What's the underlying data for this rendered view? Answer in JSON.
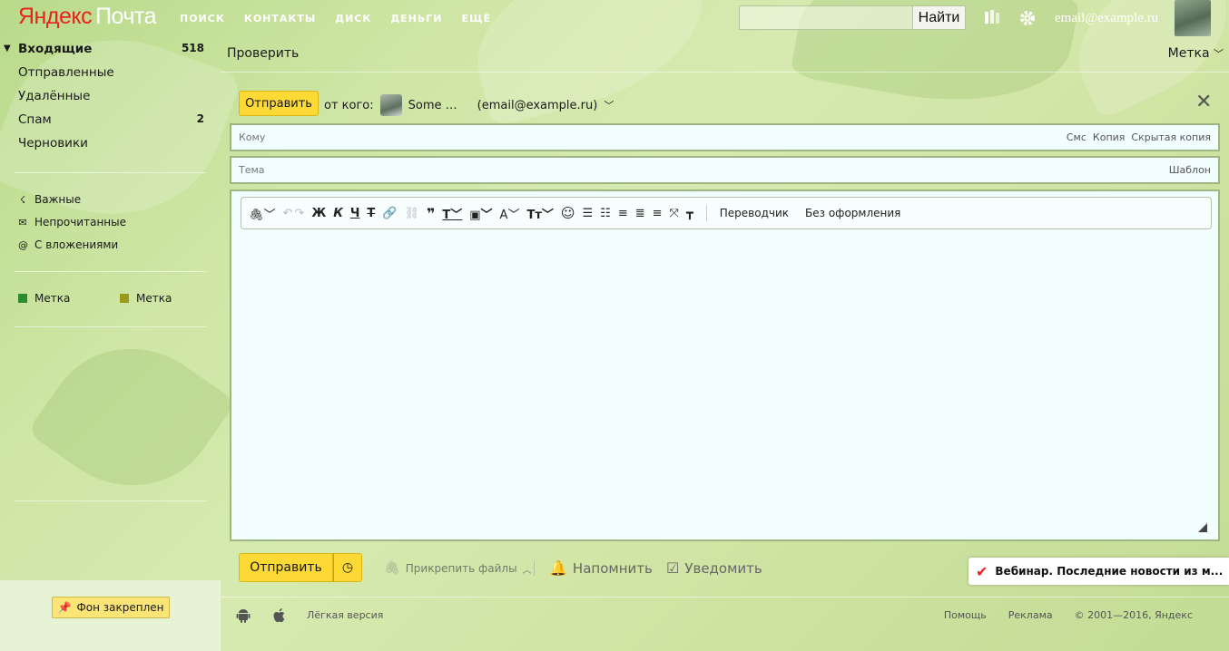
{
  "header": {
    "logo_brand": "Яндекс",
    "logo_product": "Почта",
    "nav": [
      "ПОИСК",
      "КОНТАКТЫ",
      "ДИСК",
      "ДЕНЬГИ",
      "ЕЩЁ"
    ],
    "search_button": "Найти",
    "search_placeholder": "",
    "user_email": "email@example.ru"
  },
  "sidebar": {
    "folders": [
      {
        "label": "Входящие",
        "count": "518",
        "active": true
      },
      {
        "label": "Отправленные",
        "count": ""
      },
      {
        "label": "Удалённые",
        "count": ""
      },
      {
        "label": "Спам",
        "count": "2"
      },
      {
        "label": "Черновики",
        "count": ""
      }
    ],
    "filters": [
      {
        "label": "Важные",
        "icon": "important-icon"
      },
      {
        "label": "Непрочитанные",
        "icon": "envelope-icon"
      },
      {
        "label": "С вложениями",
        "icon": "paperclip-icon"
      }
    ],
    "labels": [
      {
        "label": "Метка",
        "color": "#2e8b2e"
      },
      {
        "label": "Метка",
        "color": "#9a9a1a"
      }
    ],
    "pin_button": "Фон закреплен"
  },
  "toolbar_top": {
    "check": "Проверить",
    "label_menu": "Метка"
  },
  "compose": {
    "send_label": "Отправить",
    "from_prefix": "от кого:",
    "from_name": "Some …",
    "from_email": "(email@example.ru)",
    "to_placeholder": "Кому",
    "to_links": [
      "Смс",
      "Копия",
      "Скрытая копия"
    ],
    "subject_placeholder": "Тема",
    "template_link": "Шаблон",
    "editor_buttons": {
      "translator": "Переводчик",
      "plain": "Без оформления"
    }
  },
  "bottom": {
    "send_label": "Отправить",
    "attach": "Прикрепить файлы",
    "remind": "Напомнить",
    "notify": "Уведомить",
    "webinar": "Вебинар. Последние новости из м..."
  },
  "footer": {
    "lite": "Лёгкая версия",
    "help": "Помощь",
    "ads": "Реклама",
    "copyright": "© 2001—2016, Яндекс"
  },
  "colors": {
    "accent_yellow": "#fcd934",
    "brand_red": "#e8231f"
  }
}
